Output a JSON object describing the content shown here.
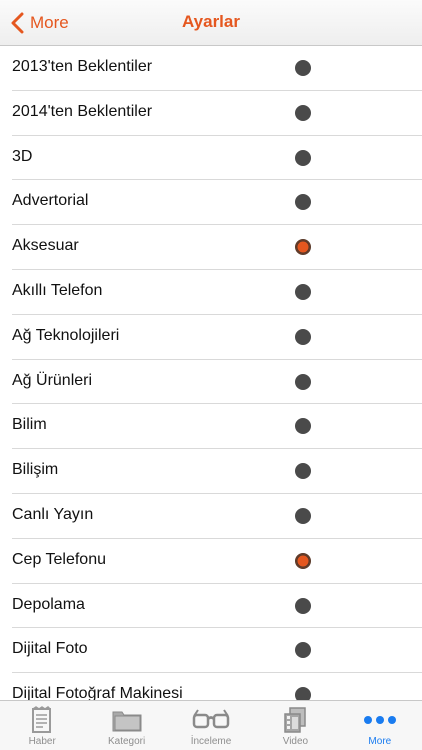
{
  "header": {
    "back_label": "More",
    "title": "Ayarlar"
  },
  "colors": {
    "accent": "#e5571f",
    "dot_off": "#4a4a4a",
    "tab_active": "#1a7cf0"
  },
  "settings": {
    "items": [
      {
        "label": "2013'ten Beklentiler",
        "selected": false
      },
      {
        "label": "2014'ten Beklentiler",
        "selected": false
      },
      {
        "label": "3D",
        "selected": false
      },
      {
        "label": "Advertorial",
        "selected": false
      },
      {
        "label": "Aksesuar",
        "selected": true
      },
      {
        "label": "Akıllı Telefon",
        "selected": false
      },
      {
        "label": "Ağ Teknolojileri",
        "selected": false
      },
      {
        "label": "Ağ Ürünleri",
        "selected": false
      },
      {
        "label": "Bilim",
        "selected": false
      },
      {
        "label": "Bilişim",
        "selected": false
      },
      {
        "label": "Canlı Yayın",
        "selected": false
      },
      {
        "label": "Cep Telefonu",
        "selected": true
      },
      {
        "label": "Depolama",
        "selected": false
      },
      {
        "label": "Dijital Foto",
        "selected": false
      },
      {
        "label": "Dijital Fotoğraf Makinesi",
        "selected": false
      }
    ]
  },
  "tabbar": {
    "tabs": [
      {
        "label": "Haber",
        "icon": "newspaper-icon",
        "active": false
      },
      {
        "label": "Kategori",
        "icon": "folder-icon",
        "active": false
      },
      {
        "label": "İnceleme",
        "icon": "glasses-icon",
        "active": false
      },
      {
        "label": "Video",
        "icon": "video-icon",
        "active": false
      },
      {
        "label": "More",
        "icon": "more-dots-icon",
        "active": true
      }
    ]
  }
}
